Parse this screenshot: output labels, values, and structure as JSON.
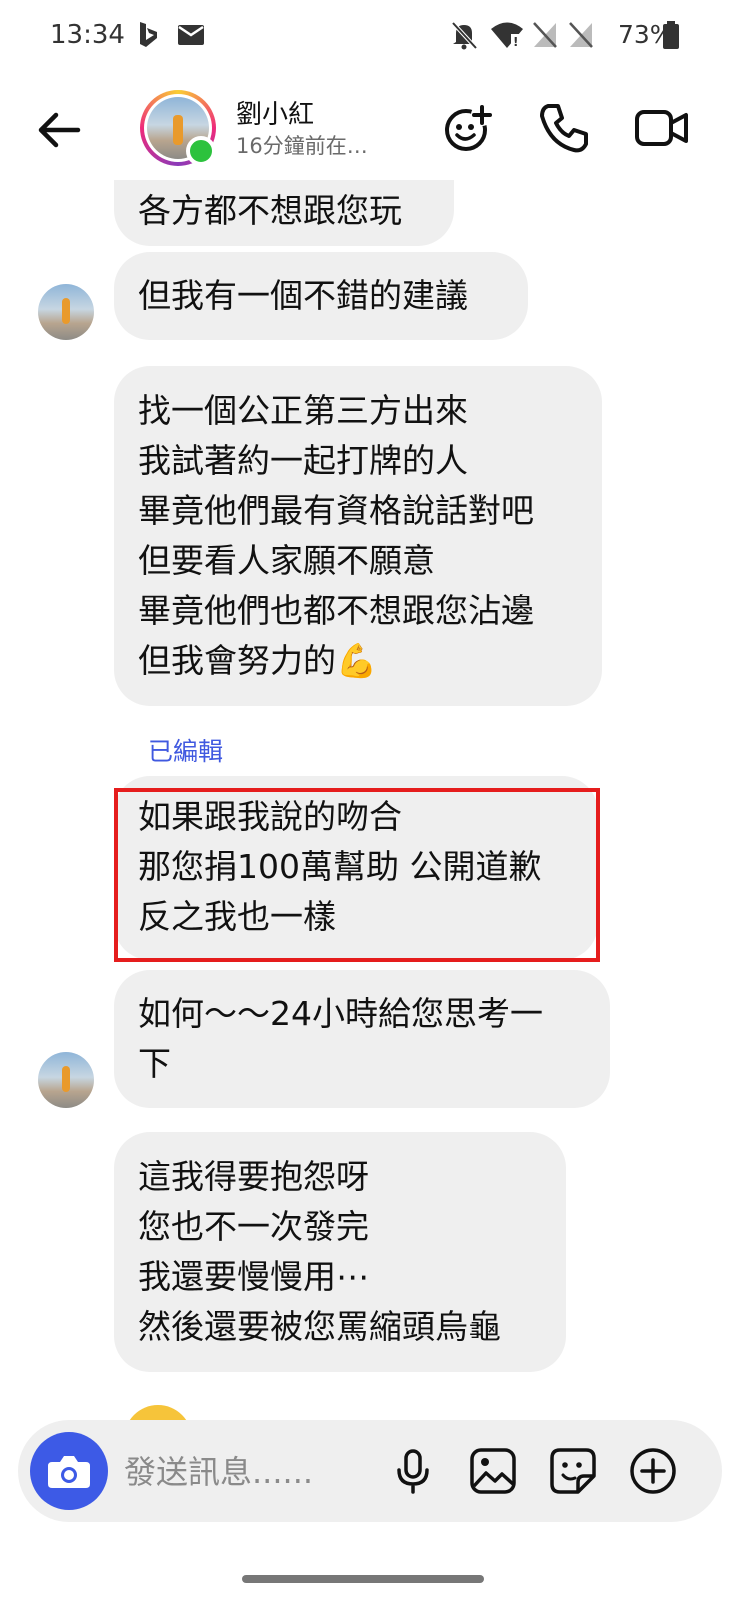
{
  "status_bar": {
    "time": "13:34",
    "battery": "73%",
    "icons": [
      "bing-icon",
      "mail-icon",
      "notifications-off-icon",
      "wifi-icon",
      "no-signal-icon",
      "no-signal-icon",
      "battery-icon"
    ]
  },
  "header": {
    "contact_name": "劉小紅",
    "status": "16分鐘前在…",
    "online": true,
    "buttons": [
      "back-arrow-icon",
      "add-friend-icon",
      "phone-icon",
      "video-camera-icon"
    ]
  },
  "messages": [
    {
      "lines": [
        "各方都不想跟您玩"
      ]
    },
    {
      "lines": [
        "但我有一個不錯的建議"
      ]
    },
    {
      "lines": [
        "找一個公正第三方出來",
        "我試著約一起打牌的人",
        "畢竟他們最有資格說話對吧",
        "但要看人家願不願意",
        "畢竟他們也都不想跟您沾邊",
        "但我會努力的💪"
      ]
    },
    {
      "edited_label": "已編輯",
      "lines": [
        "如果跟我說的吻合",
        "那您捐100萬幫助 公開道歉",
        "反之我也一樣"
      ],
      "highlighted": true
    },
    {
      "lines": [
        "如何～～24小時給您思考一",
        "下"
      ]
    },
    {
      "lines": [
        "這我得要抱怨呀",
        "您也不一次發完",
        "我還要慢慢用⋯",
        "然後還要被您罵縮頭烏龜"
      ]
    }
  ],
  "composer": {
    "placeholder": "發送訊息......",
    "icons": [
      "camera-icon",
      "microphone-icon",
      "image-icon",
      "sticker-icon",
      "plus-circle-icon"
    ]
  },
  "colors": {
    "accent": "#3d5ae6",
    "bubble": "#efefef",
    "edited_label": "#4059e0",
    "highlight_box": "#e51d1d",
    "online": "#2cc23d"
  }
}
